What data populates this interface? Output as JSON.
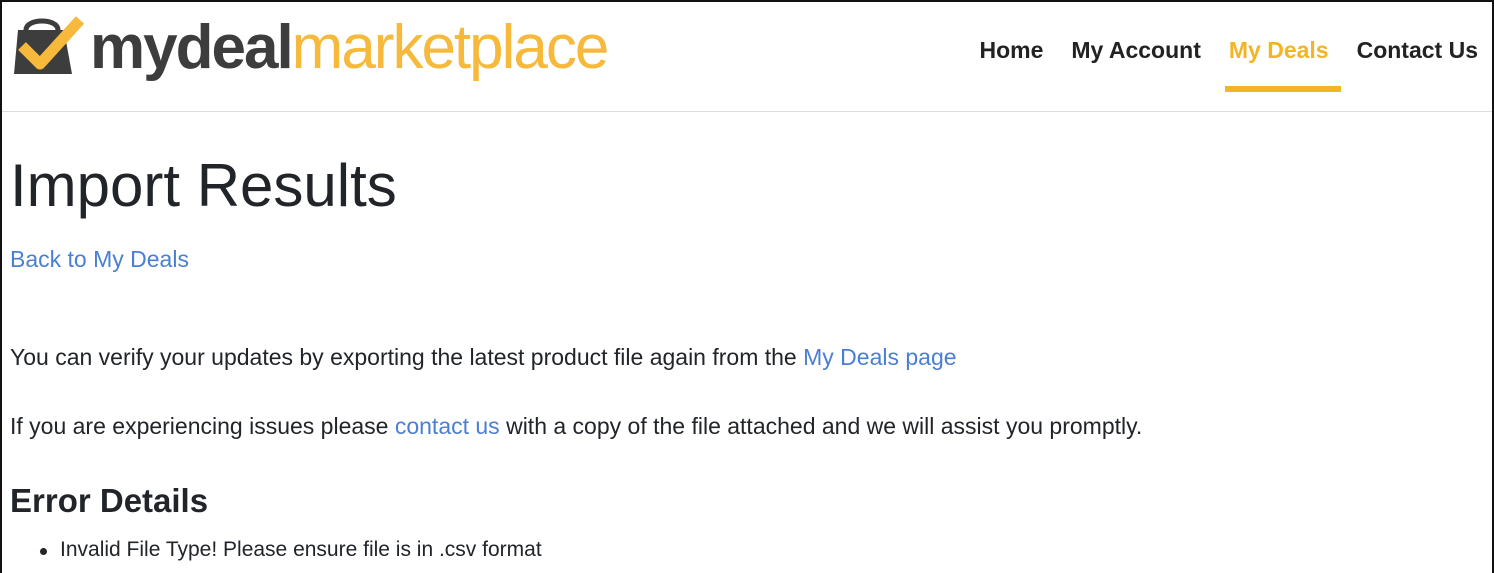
{
  "header": {
    "logo": {
      "bold_text": "mydeal",
      "light_text": "marketplace",
      "icon": "shopping-bag-check-icon",
      "brand_dark": "#3d3d3d",
      "brand_accent": "#f6b93b"
    },
    "nav": [
      {
        "label": "Home",
        "active": false
      },
      {
        "label": "My Account",
        "active": false
      },
      {
        "label": "My Deals",
        "active": true
      },
      {
        "label": "Contact Us",
        "active": false
      }
    ],
    "active_color": "#f3b526"
  },
  "main": {
    "title": "Import Results",
    "back_link": "Back to My Deals",
    "verify_text": "You can verify your updates by exporting the latest product file again from the ",
    "verify_link": "My Deals page",
    "issues_text_before": "If you are experiencing issues please ",
    "issues_link": "contact us",
    "issues_text_after": " with a copy of the file attached and we will assist you promptly.",
    "error_section_title": "Error Details",
    "errors": [
      "Invalid File Type! Please ensure file is in .csv format"
    ],
    "link_color": "#4a7fd3"
  }
}
